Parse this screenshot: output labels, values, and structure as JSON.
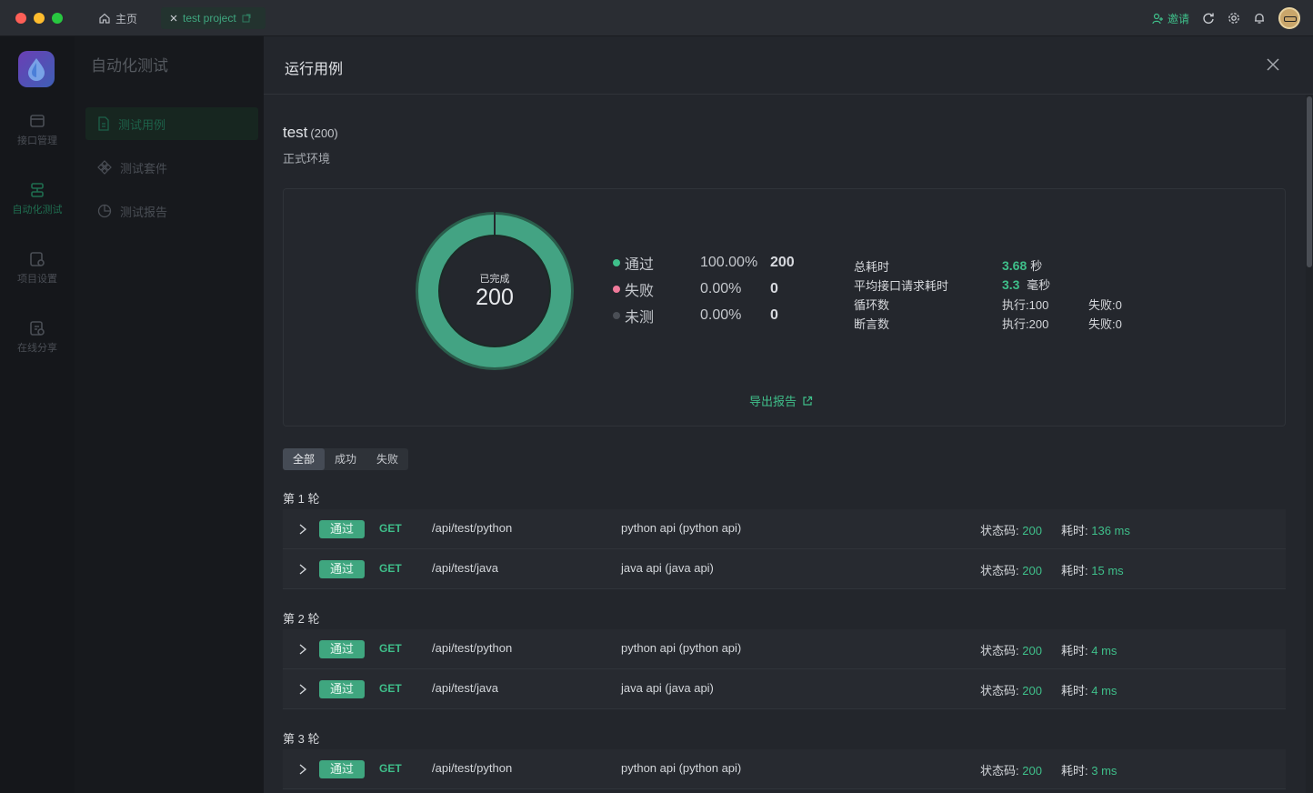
{
  "titlebar": {
    "home_tab": "主页",
    "project_tab": "test project",
    "invite": "邀请"
  },
  "rail": {
    "items": [
      {
        "label": "接口管理",
        "icon": "api-icon"
      },
      {
        "label": "自动化测试",
        "icon": "automation-icon"
      },
      {
        "label": "项目设置",
        "icon": "project-settings-icon"
      },
      {
        "label": "在线分享",
        "icon": "share-icon"
      }
    ]
  },
  "sidebar": {
    "title": "自动化测试",
    "items": [
      {
        "label": "测试用例",
        "icon": "document-icon"
      },
      {
        "label": "测试套件",
        "icon": "suite-icon"
      },
      {
        "label": "测试报告",
        "icon": "pie-chart-icon"
      }
    ]
  },
  "drawer": {
    "title": "运行用例",
    "project_name": "test",
    "project_count": "(200)",
    "environment": "正式环境"
  },
  "summary": {
    "donut_caption": "已完成",
    "donut_total": "200",
    "legend": [
      {
        "name": "通过",
        "pct": "100.00%",
        "num": "200",
        "color": "#3fbf8a"
      },
      {
        "name": "失败",
        "pct": "0.00%",
        "num": "0",
        "color": "#f07a9a"
      },
      {
        "name": "未测",
        "pct": "0.00%",
        "num": "0",
        "color": "#4a4e55"
      }
    ],
    "stats": {
      "total_time_label": "总耗时",
      "total_time_value": "3.68",
      "total_time_unit": "秒",
      "avg_label": "平均接口请求耗时",
      "avg_value": "3.3",
      "avg_unit": "毫秒",
      "loops_label": "循环数",
      "loops_exec": "执行:100",
      "loops_fail": "失败:0",
      "assert_label": "断言数",
      "assert_exec": "执行:200",
      "assert_fail": "失败:0"
    },
    "export": "导出报告"
  },
  "filter": {
    "all": "全部",
    "success": "成功",
    "fail": "失败"
  },
  "rounds": [
    {
      "title": "第 1 轮",
      "rows": [
        {
          "status": "通过",
          "method": "GET",
          "path": "/api/test/python",
          "desc": "python api (python api)",
          "code_label": "状态码:",
          "code": "200",
          "time_label": "耗时:",
          "time": "136 ms"
        },
        {
          "status": "通过",
          "method": "GET",
          "path": "/api/test/java",
          "desc": "java api (java api)",
          "code_label": "状态码:",
          "code": "200",
          "time_label": "耗时:",
          "time": "15 ms"
        }
      ]
    },
    {
      "title": "第 2 轮",
      "rows": [
        {
          "status": "通过",
          "method": "GET",
          "path": "/api/test/python",
          "desc": "python api (python api)",
          "code_label": "状态码:",
          "code": "200",
          "time_label": "耗时:",
          "time": "4 ms"
        },
        {
          "status": "通过",
          "method": "GET",
          "path": "/api/test/java",
          "desc": "java api (java api)",
          "code_label": "状态码:",
          "code": "200",
          "time_label": "耗时:",
          "time": "4 ms"
        }
      ]
    },
    {
      "title": "第 3 轮",
      "rows": [
        {
          "status": "通过",
          "method": "GET",
          "path": "/api/test/python",
          "desc": "python api (python api)",
          "code_label": "状态码:",
          "code": "200",
          "time_label": "耗时:",
          "time": "3 ms"
        }
      ]
    }
  ],
  "colors": {
    "accent": "#3fbf8a",
    "badge": "#3fa67f",
    "fail": "#f07a9a"
  }
}
